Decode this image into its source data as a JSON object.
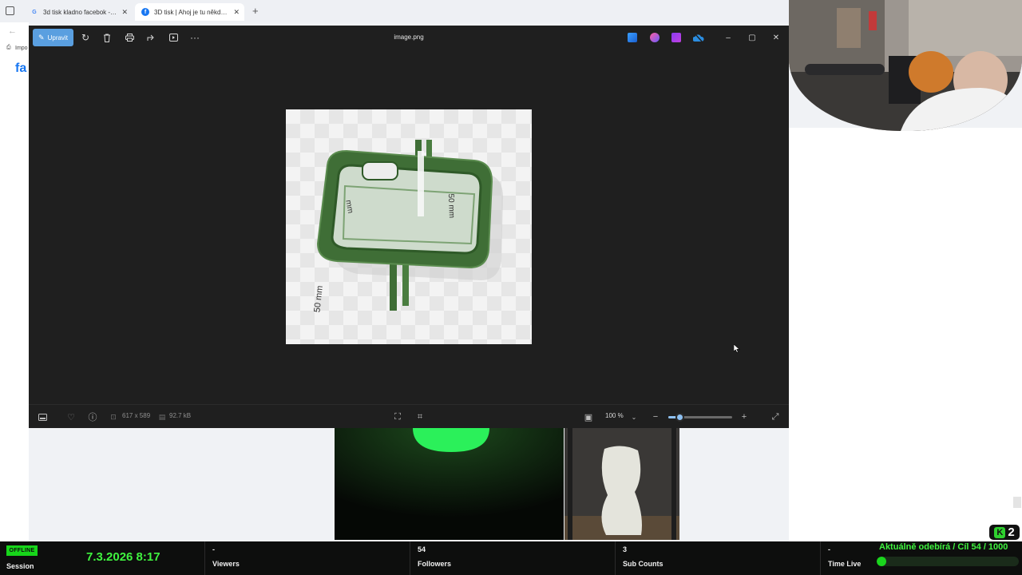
{
  "browser": {
    "tabs": [
      {
        "title": "3d tisk kladno facebok - Hledat",
        "favicon": "G",
        "active": false
      },
      {
        "title": "3D tisk | Ahoj je tu někdo z Kladna",
        "favicon": "f",
        "active": true
      }
    ],
    "new_tab_label": "+",
    "bookmark_label": "Impo",
    "facebook_logo_text": "fa"
  },
  "viewer": {
    "title": "image.png",
    "edit_label": "Upravit",
    "window_controls": {
      "minimize": "–",
      "maximize": "▢",
      "close": "✕"
    },
    "status": {
      "dimensions": "617 x 589",
      "file_size": "92.7 kB",
      "zoom_value": "100 %",
      "zoom_level": 0.18
    },
    "image_labels": {
      "left": "mm",
      "right": "50 mm",
      "bottom": "50 mm"
    }
  },
  "stream_bar": {
    "status_badge": "OFFLINE",
    "session_label": "Session",
    "datetime": "7.3.2026 8:17",
    "viewers_value": "-",
    "viewers_label": "Viewers",
    "followers_value": "54",
    "followers_label": "Followers",
    "subs_value": "3",
    "subs_label": "Sub Counts",
    "timelive_value": "-",
    "timelive_label": "Time Live",
    "goal_text": "Aktuálně odebírá / Cíl   54 / 1000",
    "goal_progress": 0.054,
    "badge_number": "2"
  },
  "colors": {
    "accent_green": "#3ff33f",
    "edit_blue": "#5a9fe0",
    "model_green": "#3f6e36"
  }
}
